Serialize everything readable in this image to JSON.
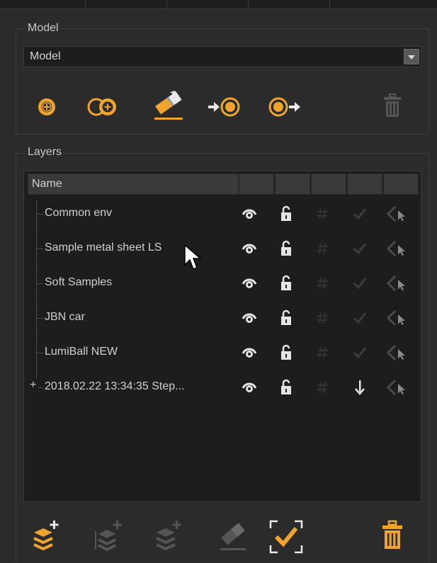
{
  "model_group": {
    "title": "Model",
    "select_value": "Model",
    "toolbar": [
      {
        "icon": "add-icon"
      },
      {
        "icon": "add-duplicate-icon"
      },
      {
        "icon": "edit-model-icon"
      },
      {
        "icon": "import-icon"
      },
      {
        "icon": "export-icon"
      },
      {
        "icon": "trash-icon"
      }
    ]
  },
  "layers_group": {
    "title": "Layers",
    "header": {
      "name": "Name"
    },
    "rows": [
      {
        "name": "Common env",
        "expandable": false,
        "status": "check"
      },
      {
        "name": "Sample metal sheet LS",
        "expandable": false,
        "status": "check"
      },
      {
        "name": "Soft Samples",
        "expandable": false,
        "status": "check"
      },
      {
        "name": "JBN car",
        "expandable": false,
        "status": "check"
      },
      {
        "name": "LumiBall NEW",
        "expandable": false,
        "status": "check"
      },
      {
        "name": "2018.02.22 13:34:35 Step...",
        "expandable": true,
        "expand_symbol": "+",
        "status": "down-arrow"
      }
    ],
    "bottom_toolbar": [
      {
        "icon": "add-layer-icon"
      },
      {
        "icon": "add-sublayer-icon"
      },
      {
        "icon": "duplicate-layer-icon"
      },
      {
        "icon": "edit-layer-icon"
      },
      {
        "icon": "select-check-icon"
      },
      {
        "icon": "delete-layer-icon"
      }
    ]
  },
  "colors": {
    "accent": "#f0a42c",
    "background": "#2b2b2b",
    "list_background": "#1d1d1d",
    "text": "#d0d0d0"
  }
}
